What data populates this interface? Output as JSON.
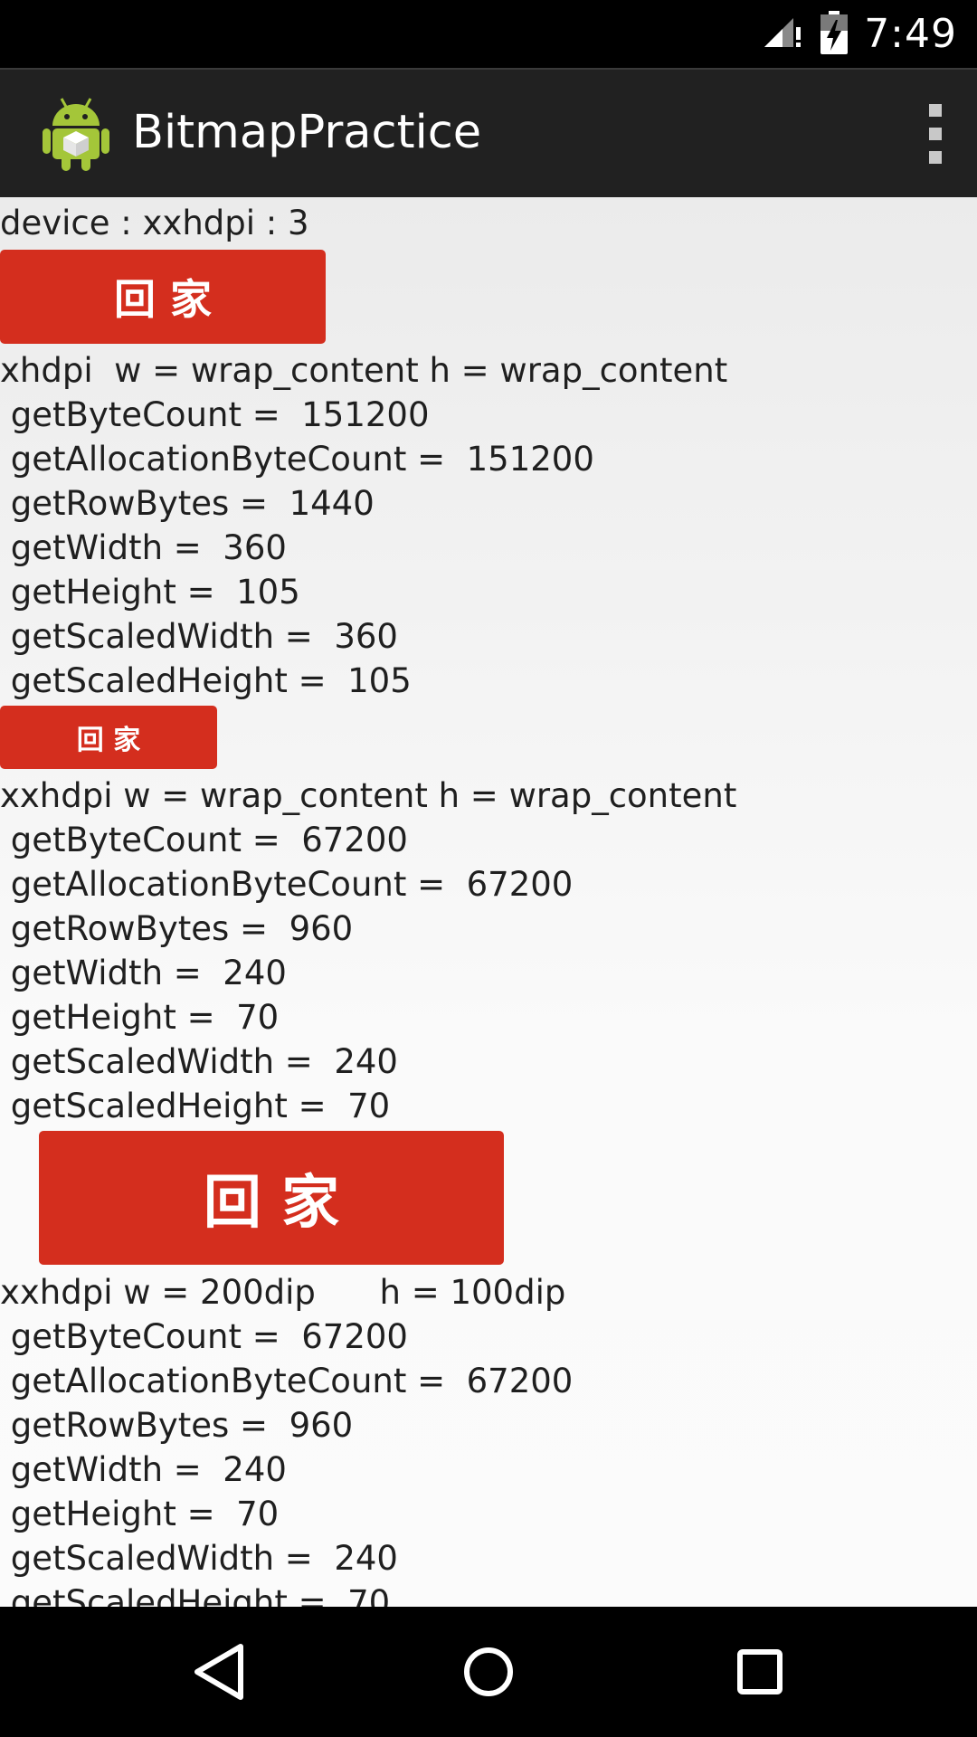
{
  "status_bar": {
    "time": "7:49",
    "icons": [
      "signal-icon",
      "battery-charging-icon"
    ]
  },
  "action_bar": {
    "title": "BitmapPractice",
    "app_icon": "android-app-icon",
    "menu_icon": "overflow-menu-icon"
  },
  "content": {
    "device_line": "device : xxhdpi : 3",
    "blocks": [
      {
        "button_label": "回 家",
        "header": "xhdpi  w = wrap_content h = wrap_content",
        "stats": [
          " getByteCount =  151200",
          " getAllocationByteCount =  151200",
          " getRowBytes =  1440",
          " getWidth =  360",
          " getHeight =  105",
          " getScaledWidth =  360",
          " getScaledHeight =  105"
        ]
      },
      {
        "button_label": "回 家",
        "header": "xxhdpi w = wrap_content h = wrap_content",
        "stats": [
          " getByteCount =  67200",
          " getAllocationByteCount =  67200",
          " getRowBytes =  960",
          " getWidth =  240",
          " getHeight =  70",
          " getScaledWidth =  240",
          " getScaledHeight =  70"
        ]
      },
      {
        "button_label": "回 家",
        "header": "xxhdpi w = 200dip      h = 100dip",
        "stats": [
          " getByteCount =  67200",
          " getAllocationByteCount =  67200",
          " getRowBytes =  960",
          " getWidth =  240",
          " getHeight =  70",
          " getScaledWidth =  240",
          " getScaledHeight =  70"
        ]
      }
    ]
  },
  "nav_bar": {
    "icons": [
      "back-icon",
      "home-icon",
      "recents-icon"
    ]
  },
  "colors": {
    "button": "#d42e1e",
    "action_bar": "#212121",
    "status_bar": "#000000",
    "android_green": "#a4c639"
  }
}
